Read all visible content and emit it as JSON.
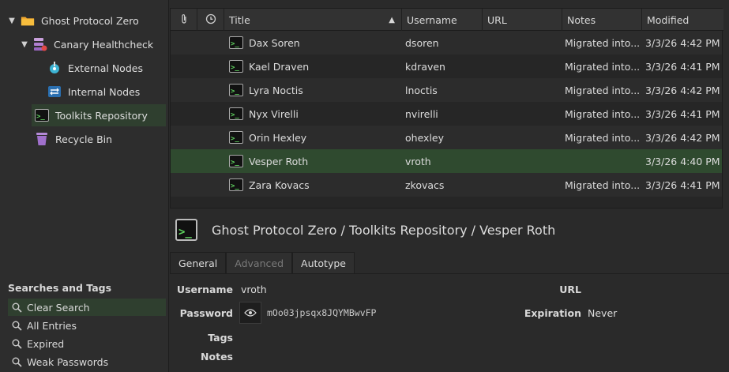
{
  "tree": {
    "items": [
      {
        "label": "Ghost Protocol Zero",
        "icon": "folder-icon"
      },
      {
        "label": "Canary Healthcheck",
        "icon": "database-icon"
      },
      {
        "label": "External Nodes",
        "icon": "node-icon"
      },
      {
        "label": "Internal Nodes",
        "icon": "network-icon"
      },
      {
        "label": "Toolkits Repository",
        "icon": "terminal-icon"
      },
      {
        "label": "Recycle Bin",
        "icon": "trash-icon"
      }
    ]
  },
  "search": {
    "title": "Searches and Tags",
    "items": [
      "Clear Search",
      "All Entries",
      "Expired",
      "Weak Passwords"
    ]
  },
  "table": {
    "columns": {
      "title": "Title",
      "username": "Username",
      "url": "URL",
      "notes": "Notes",
      "modified": "Modified"
    },
    "rows": [
      {
        "title": "Dax Soren",
        "username": "dsoren",
        "url": "",
        "notes": "Migrated into...",
        "modified": "3/3/26 4:42 PM"
      },
      {
        "title": "Kael Draven",
        "username": "kdraven",
        "url": "",
        "notes": "Migrated into...",
        "modified": "3/3/26 4:41 PM"
      },
      {
        "title": "Lyra Noctis",
        "username": "lnoctis",
        "url": "",
        "notes": "Migrated into...",
        "modified": "3/3/26 4:42 PM"
      },
      {
        "title": "Nyx Virelli",
        "username": "nvirelli",
        "url": "",
        "notes": "Migrated into...",
        "modified": "3/3/26 4:41 PM"
      },
      {
        "title": "Orin Hexley",
        "username": "ohexley",
        "url": "",
        "notes": "Migrated into...",
        "modified": "3/3/26 4:42 PM"
      },
      {
        "title": "Vesper Roth",
        "username": "vroth",
        "url": "",
        "notes": "",
        "modified": "3/3/26 4:40 PM"
      },
      {
        "title": "Zara Kovacs",
        "username": "zkovacs",
        "url": "",
        "notes": "Migrated into...",
        "modified": "3/3/26 4:41 PM"
      }
    ]
  },
  "detail": {
    "breadcrumb": "Ghost Protocol Zero / Toolkits Repository / Vesper Roth",
    "tabs": {
      "general": "General",
      "advanced": "Advanced",
      "autotype": "Autotype"
    },
    "labels": {
      "username": "Username",
      "password": "Password",
      "tags": "Tags",
      "notes": "Notes",
      "url": "URL",
      "expiration": "Expiration"
    },
    "values": {
      "username": "vroth",
      "password": "mOo03jpsqx8JQYMBwvFP",
      "expiration": "Never"
    }
  },
  "colors": {
    "selection": "#2f4a2f",
    "terminal_green": "#5fd35f"
  }
}
